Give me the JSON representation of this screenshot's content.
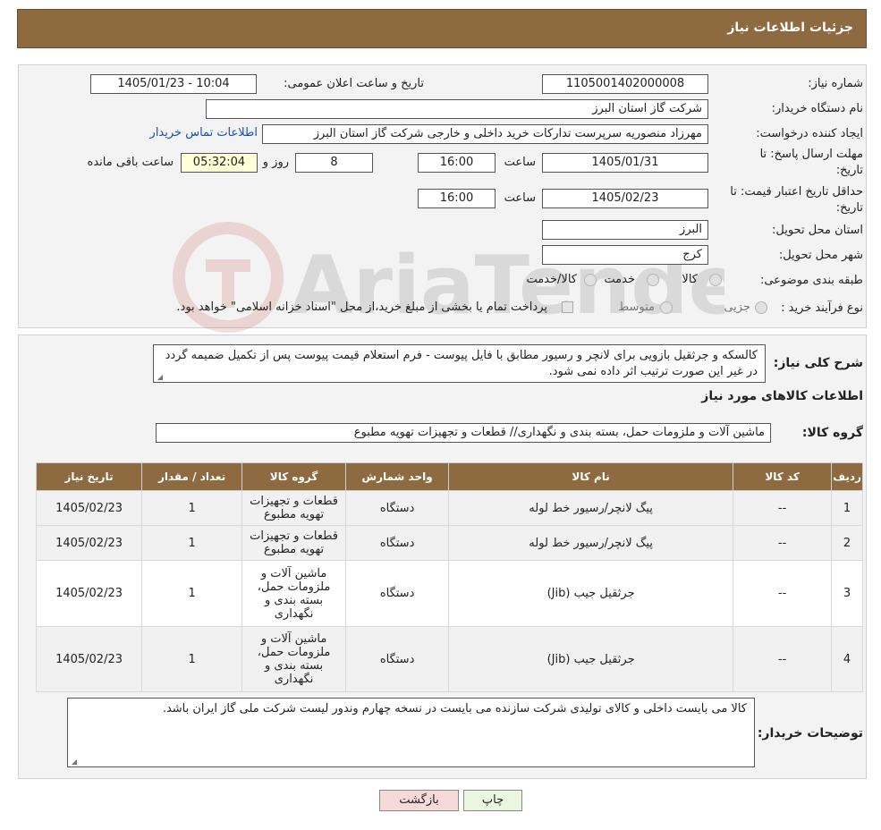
{
  "header": {
    "title": "جزئیات اطلاعات نیاز"
  },
  "form": {
    "need_number_label": "شماره نیاز:",
    "need_number": "1105001402000008",
    "announce_label": "تاریخ و ساعت اعلان عمومی:",
    "announce_value": "1405/01/23 - 10:04",
    "buyer_org_label": "نام دستگاه خریدار:",
    "buyer_org": "شرکت گاز استان البرز",
    "creator_label": "ایجاد کننده درخواست:",
    "creator": "مهرزاد منصوریه سرپرست تدارکات خرید داخلی و خارجی شرکت گاز استان البرز",
    "contact_link": "اطلاعات تماس خریدار",
    "deadline_label_1": "مهلت ارسال پاسخ: تا",
    "deadline_label_2": "تاریخ:",
    "deadline_date": "1405/01/31",
    "time_label": "ساعت",
    "deadline_time": "16:00",
    "days_value": "8",
    "days_label": "روز و",
    "remaining_time": "05:32:04",
    "remaining_label": "ساعت باقی مانده",
    "validity_label_1": "حداقل تاریخ اعتبار قیمت: تا",
    "validity_label_2": "تاریخ:",
    "validity_date": "1405/02/23",
    "validity_time": "16:00",
    "province_label": "استان محل تحویل:",
    "province": "البرز",
    "city_label": "شهر محل تحویل:",
    "city": "کرج",
    "category_label": "طبقه بندی موضوعی:",
    "category_options": [
      "کالا",
      "خدمت",
      "کالا/خدمت"
    ],
    "process_label": "نوع فرآیند خرید :",
    "process_options": [
      "جزیی",
      "متوسط"
    ],
    "process_note": "پرداخت تمام یا بخشی از مبلغ خرید،از محل \"اسناد خزانه اسلامی\" خواهد بود."
  },
  "description": {
    "label": "شرح کلی نیاز:",
    "text": "کالسکه و جرثقیل بازویی برای لانچر و رسیور مطابق با فایل پیوست - فرم استعلام قیمت پیوست پس از تکمیل ضمیمه گردد در غیر این صورت ترتیب اثر داده نمی شود."
  },
  "goods": {
    "section_title": "اطلاعات کالاهای مورد نیاز",
    "group_label": "گروه کالا:",
    "group_value": "ماشین آلات و ملزومات حمل، بسته بندی و نگهداری//  قطعات و تجهیزات تهویه مطبوع",
    "columns": [
      "ردیف",
      "کد کالا",
      "نام کالا",
      "واحد شمارش",
      "گروه کالا",
      "تعداد / مقدار",
      "تاریخ نیاز"
    ],
    "rows": [
      {
        "row": "1",
        "code": "--",
        "name": "پیگ لانچر/رسیور خط لوله",
        "unit": "دستگاه",
        "group": "قطعات و تجهیزات تهویه مطبوع",
        "qty": "1",
        "date": "1405/02/23"
      },
      {
        "row": "2",
        "code": "--",
        "name": "پیگ لانچر/رسیور خط لوله",
        "unit": "دستگاه",
        "group": "قطعات و تجهیزات تهویه مطبوع",
        "qty": "1",
        "date": "1405/02/23"
      },
      {
        "row": "3",
        "code": "--",
        "name": "جرثقیل جیب (Jib)",
        "unit": "دستگاه",
        "group": "ماشین آلات و ملزومات حمل، بسته بندی و نگهداری",
        "qty": "1",
        "date": "1405/02/23"
      },
      {
        "row": "4",
        "code": "--",
        "name": "جرثقیل جیب (Jib)",
        "unit": "دستگاه",
        "group": "ماشین آلات و ملزومات حمل، بسته بندی و نگهداری",
        "qty": "1",
        "date": "1405/02/23"
      }
    ]
  },
  "buyer_notes": {
    "label": "توضیحات خریدار:",
    "text": "کالا می بایست داخلی و کالای تولیدی شرکت سازنده می بایست در نسخه چهارم وندور لیست شرکت ملی گاز ایران باشد."
  },
  "buttons": {
    "print": "چاپ",
    "back": "بازگشت"
  },
  "colors": {
    "header_brown": "#8d6a3f",
    "link_blue": "#1a4db8",
    "back_pink": "#f8d9d9",
    "print_green": "#eaf6de"
  }
}
